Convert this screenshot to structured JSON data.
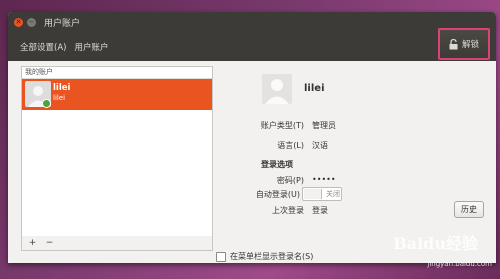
{
  "window": {
    "title": "用户账户"
  },
  "menubar": {
    "all_settings": "全部设置(A)",
    "user_accounts": "用户账户"
  },
  "unlock_button": {
    "label": "解锁"
  },
  "account_list": {
    "header": "我的账户",
    "users": [
      {
        "name": "lilei",
        "subtitle": "lilei",
        "online": true
      }
    ],
    "add_label": "+",
    "remove_label": "−"
  },
  "details": {
    "name": "lilei",
    "account_type_label": "账户类型(T)",
    "account_type_value": "管理员",
    "language_label": "语言(L)",
    "language_value": "汉语",
    "login_options_title": "登录选项",
    "password_label": "密码(P)",
    "password_value": "•••••",
    "auto_login_label": "自动登录(U)",
    "auto_login_state": "关闭",
    "last_login_label": "上次登录",
    "last_login_value": "登录",
    "history_button": "历史",
    "show_name_checkbox": "在菜单栏显示登录名(S)"
  },
  "watermark": {
    "text": "Baidu经验",
    "url": "jingyan.baidu.com"
  },
  "colors": {
    "accent": "#e95420",
    "titlebar": "#3c3b37",
    "highlight": "#e0407a"
  }
}
